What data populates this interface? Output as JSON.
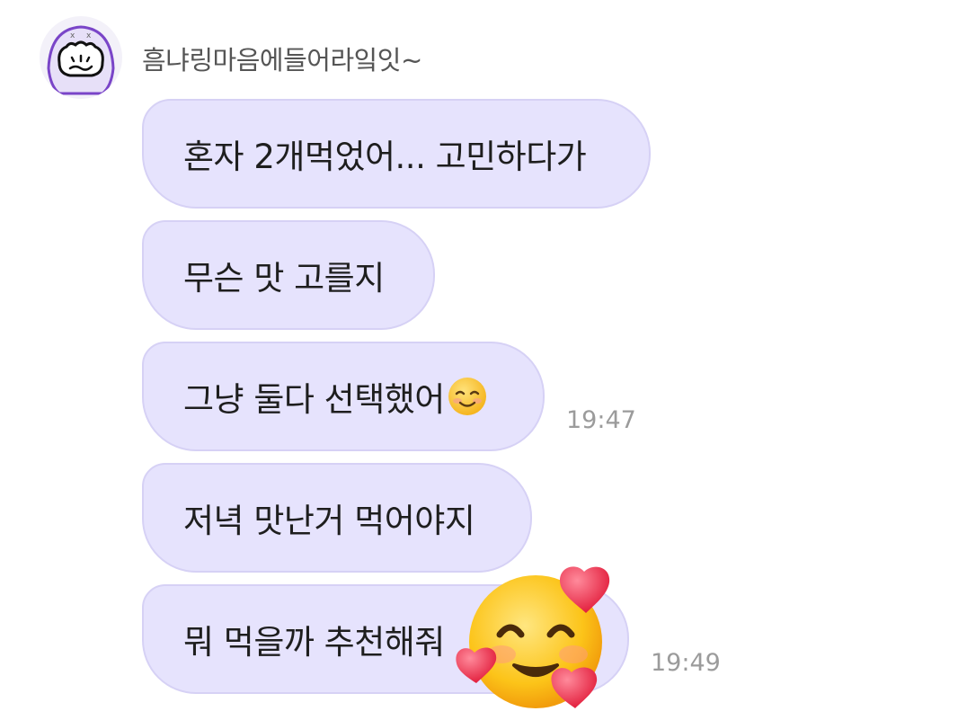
{
  "chat": {
    "sender_name": "흠냐링마음에들어라잌잇~",
    "avatar_icon": "cartoon-face-avatar-icon",
    "messages": [
      {
        "text": "혼자 2개먹었어... 고민하다가"
      },
      {
        "text": "무슨 맛 고를지"
      },
      {
        "text": "그냥 둘다 선택했어",
        "emoji": "smiling-face-icon"
      },
      {
        "text": "저녁 맛난거 먹어야지"
      },
      {
        "text": "뭐 먹을까 추천해줘"
      }
    ],
    "timestamps": [
      "19:47",
      "19:49"
    ],
    "sticker_icon": "smiling-face-with-hearts-icon"
  },
  "colors": {
    "bubble_bg": "#e6e3fd",
    "bubble_border": "#d6d1f5",
    "text": "#1e1e1e",
    "timestamp": "#9b9b9b",
    "sender": "#555555"
  }
}
